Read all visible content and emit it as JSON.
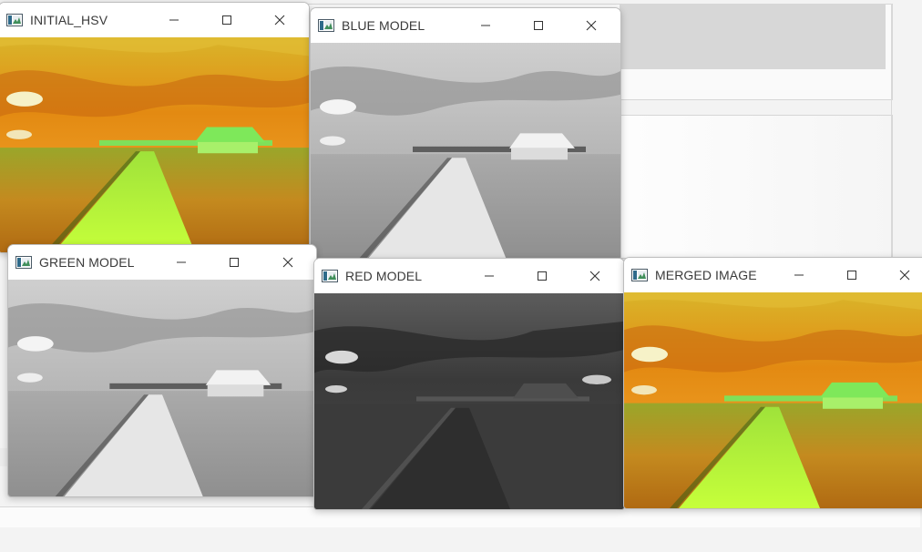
{
  "windows": {
    "initial_hsv": {
      "title": "INITIAL_HSV"
    },
    "blue_model": {
      "title": "BLUE MODEL"
    },
    "green_model": {
      "title": "GREEN MODEL"
    },
    "red_model": {
      "title": "RED MODEL"
    },
    "merged_image": {
      "title": "MERGED IMAGE"
    }
  },
  "icons": {
    "app": "image-window-icon",
    "minimize": "minimize-icon",
    "maximize": "maximize-icon",
    "close": "close-icon"
  },
  "colors": {
    "hsv_sky": "#e08a12",
    "hsv_ground": "#b88a20",
    "hsv_pier": "#8fe234",
    "hsv_house": "#7fe05a",
    "titlebar": "#ffffff",
    "desktop": "#f3f3f3"
  }
}
